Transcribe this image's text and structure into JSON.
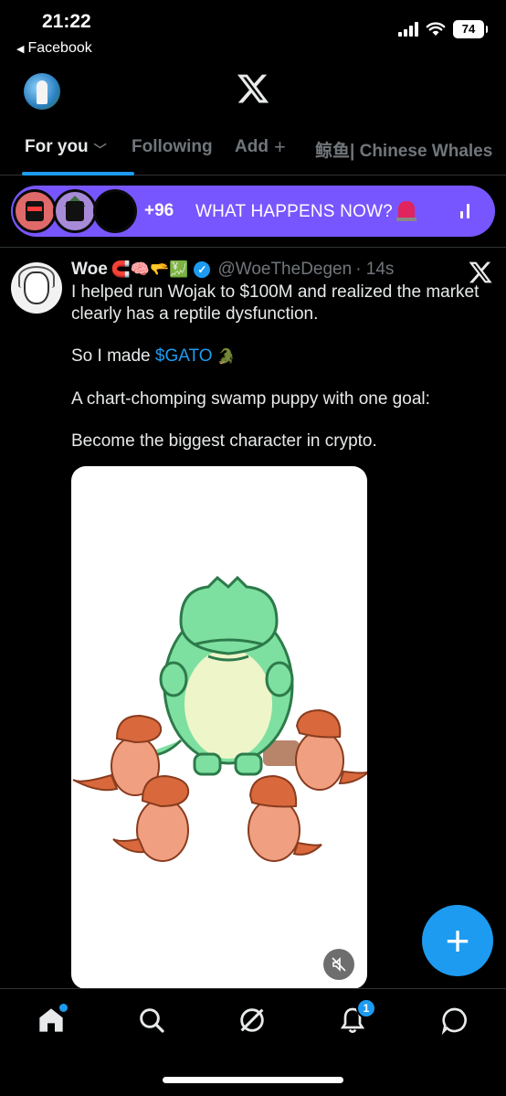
{
  "status_bar": {
    "time": "21:22",
    "back_app": "Facebook",
    "battery": "74"
  },
  "header": {
    "logo": "x-logo-icon"
  },
  "tabs": [
    {
      "label": "For you",
      "active": true
    },
    {
      "label": "Following",
      "active": false
    },
    {
      "label": "Add",
      "active": false
    },
    {
      "label": "鲸鱼| Chinese Whales",
      "active": false
    }
  ],
  "spaces": {
    "count": "+96",
    "title": "WHAT HAPPENS NOW?",
    "color": "#7856ff"
  },
  "post": {
    "author_name": "Woe",
    "author_emojis": "🧲🧠🫳💹",
    "handle": "@WoeTheDegen",
    "time": "· 14s",
    "paragraphs": {
      "p1": "I helped run Wojak to $100M and realized the market clearly has a reptile dysfunction.",
      "p2_prefix": "So I made ",
      "p2_cashtag": "$GATO",
      "p2_emoji": "🐊",
      "p3": "A chart-chomping swamp puppy with one goal:",
      "p4": "Become the biggest character in crypto."
    }
  },
  "fab": {
    "label": "+"
  },
  "nav": {
    "notif_badge": "1"
  },
  "colors": {
    "accent": "#1d9bf0",
    "background": "#000000",
    "secondary_text": "#71767b"
  }
}
